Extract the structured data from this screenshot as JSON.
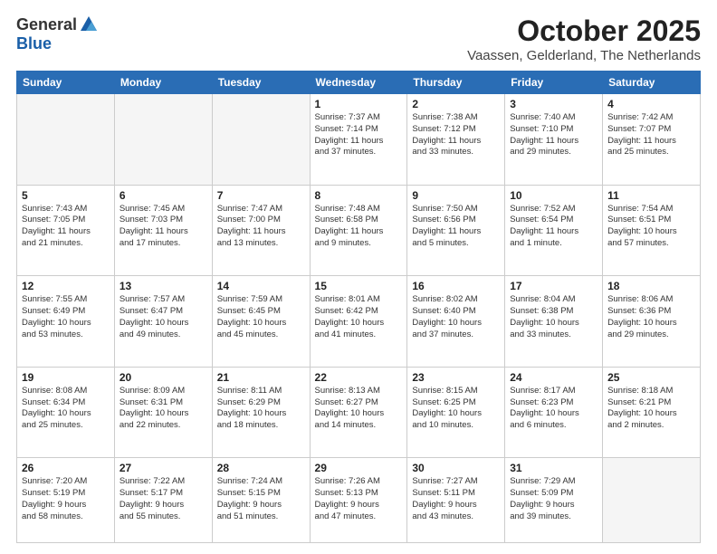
{
  "header": {
    "logo_general": "General",
    "logo_blue": "Blue",
    "month_title": "October 2025",
    "location": "Vaassen, Gelderland, The Netherlands"
  },
  "days_of_week": [
    "Sunday",
    "Monday",
    "Tuesday",
    "Wednesday",
    "Thursday",
    "Friday",
    "Saturday"
  ],
  "weeks": [
    [
      {
        "day": "",
        "info": ""
      },
      {
        "day": "",
        "info": ""
      },
      {
        "day": "",
        "info": ""
      },
      {
        "day": "1",
        "info": "Sunrise: 7:37 AM\nSunset: 7:14 PM\nDaylight: 11 hours\nand 37 minutes."
      },
      {
        "day": "2",
        "info": "Sunrise: 7:38 AM\nSunset: 7:12 PM\nDaylight: 11 hours\nand 33 minutes."
      },
      {
        "day": "3",
        "info": "Sunrise: 7:40 AM\nSunset: 7:10 PM\nDaylight: 11 hours\nand 29 minutes."
      },
      {
        "day": "4",
        "info": "Sunrise: 7:42 AM\nSunset: 7:07 PM\nDaylight: 11 hours\nand 25 minutes."
      }
    ],
    [
      {
        "day": "5",
        "info": "Sunrise: 7:43 AM\nSunset: 7:05 PM\nDaylight: 11 hours\nand 21 minutes."
      },
      {
        "day": "6",
        "info": "Sunrise: 7:45 AM\nSunset: 7:03 PM\nDaylight: 11 hours\nand 17 minutes."
      },
      {
        "day": "7",
        "info": "Sunrise: 7:47 AM\nSunset: 7:00 PM\nDaylight: 11 hours\nand 13 minutes."
      },
      {
        "day": "8",
        "info": "Sunrise: 7:48 AM\nSunset: 6:58 PM\nDaylight: 11 hours\nand 9 minutes."
      },
      {
        "day": "9",
        "info": "Sunrise: 7:50 AM\nSunset: 6:56 PM\nDaylight: 11 hours\nand 5 minutes."
      },
      {
        "day": "10",
        "info": "Sunrise: 7:52 AM\nSunset: 6:54 PM\nDaylight: 11 hours\nand 1 minute."
      },
      {
        "day": "11",
        "info": "Sunrise: 7:54 AM\nSunset: 6:51 PM\nDaylight: 10 hours\nand 57 minutes."
      }
    ],
    [
      {
        "day": "12",
        "info": "Sunrise: 7:55 AM\nSunset: 6:49 PM\nDaylight: 10 hours\nand 53 minutes."
      },
      {
        "day": "13",
        "info": "Sunrise: 7:57 AM\nSunset: 6:47 PM\nDaylight: 10 hours\nand 49 minutes."
      },
      {
        "day": "14",
        "info": "Sunrise: 7:59 AM\nSunset: 6:45 PM\nDaylight: 10 hours\nand 45 minutes."
      },
      {
        "day": "15",
        "info": "Sunrise: 8:01 AM\nSunset: 6:42 PM\nDaylight: 10 hours\nand 41 minutes."
      },
      {
        "day": "16",
        "info": "Sunrise: 8:02 AM\nSunset: 6:40 PM\nDaylight: 10 hours\nand 37 minutes."
      },
      {
        "day": "17",
        "info": "Sunrise: 8:04 AM\nSunset: 6:38 PM\nDaylight: 10 hours\nand 33 minutes."
      },
      {
        "day": "18",
        "info": "Sunrise: 8:06 AM\nSunset: 6:36 PM\nDaylight: 10 hours\nand 29 minutes."
      }
    ],
    [
      {
        "day": "19",
        "info": "Sunrise: 8:08 AM\nSunset: 6:34 PM\nDaylight: 10 hours\nand 25 minutes."
      },
      {
        "day": "20",
        "info": "Sunrise: 8:09 AM\nSunset: 6:31 PM\nDaylight: 10 hours\nand 22 minutes."
      },
      {
        "day": "21",
        "info": "Sunrise: 8:11 AM\nSunset: 6:29 PM\nDaylight: 10 hours\nand 18 minutes."
      },
      {
        "day": "22",
        "info": "Sunrise: 8:13 AM\nSunset: 6:27 PM\nDaylight: 10 hours\nand 14 minutes."
      },
      {
        "day": "23",
        "info": "Sunrise: 8:15 AM\nSunset: 6:25 PM\nDaylight: 10 hours\nand 10 minutes."
      },
      {
        "day": "24",
        "info": "Sunrise: 8:17 AM\nSunset: 6:23 PM\nDaylight: 10 hours\nand 6 minutes."
      },
      {
        "day": "25",
        "info": "Sunrise: 8:18 AM\nSunset: 6:21 PM\nDaylight: 10 hours\nand 2 minutes."
      }
    ],
    [
      {
        "day": "26",
        "info": "Sunrise: 7:20 AM\nSunset: 5:19 PM\nDaylight: 9 hours\nand 58 minutes."
      },
      {
        "day": "27",
        "info": "Sunrise: 7:22 AM\nSunset: 5:17 PM\nDaylight: 9 hours\nand 55 minutes."
      },
      {
        "day": "28",
        "info": "Sunrise: 7:24 AM\nSunset: 5:15 PM\nDaylight: 9 hours\nand 51 minutes."
      },
      {
        "day": "29",
        "info": "Sunrise: 7:26 AM\nSunset: 5:13 PM\nDaylight: 9 hours\nand 47 minutes."
      },
      {
        "day": "30",
        "info": "Sunrise: 7:27 AM\nSunset: 5:11 PM\nDaylight: 9 hours\nand 43 minutes."
      },
      {
        "day": "31",
        "info": "Sunrise: 7:29 AM\nSunset: 5:09 PM\nDaylight: 9 hours\nand 39 minutes."
      },
      {
        "day": "",
        "info": ""
      }
    ]
  ]
}
